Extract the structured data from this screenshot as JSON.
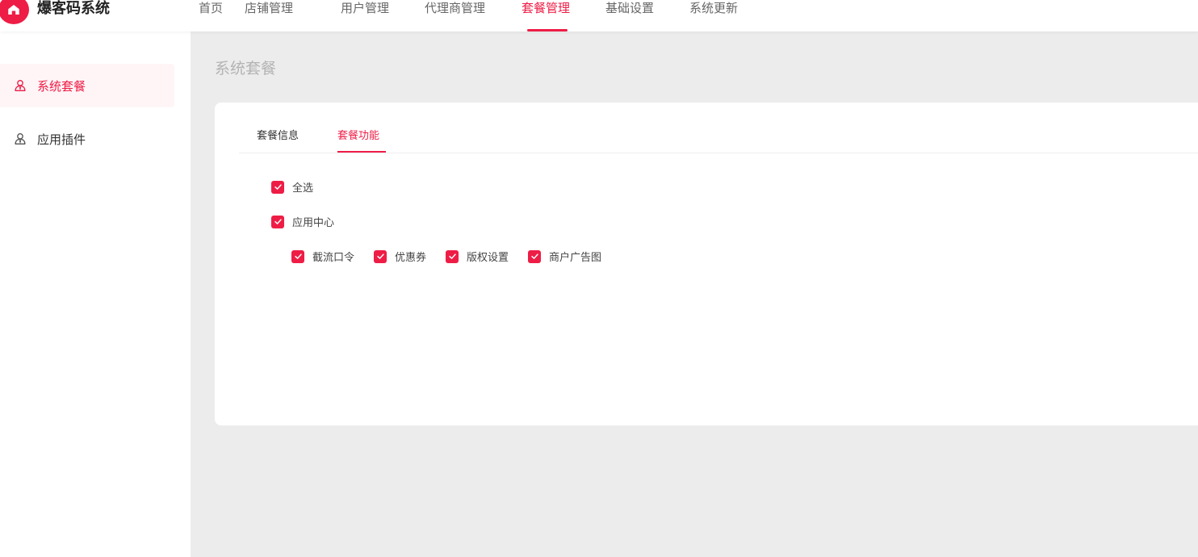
{
  "header": {
    "app_title": "爆客码系统",
    "nav": [
      {
        "label": "首页",
        "active": false
      },
      {
        "label": "店铺管理",
        "active": false
      },
      {
        "label": "用户管理",
        "active": false
      },
      {
        "label": "代理商管理",
        "active": false
      },
      {
        "label": "套餐管理",
        "active": true
      },
      {
        "label": "基础设置",
        "active": false
      },
      {
        "label": "系统更新",
        "active": false
      }
    ]
  },
  "sidebar": {
    "items": [
      {
        "label": "系统套餐",
        "icon": "user-icon",
        "active": true
      },
      {
        "label": "应用插件",
        "icon": "user-icon",
        "active": false
      }
    ]
  },
  "main": {
    "page_title": "系统套餐",
    "tabs": [
      {
        "label": "套餐信息",
        "active": false
      },
      {
        "label": "套餐功能",
        "active": true
      }
    ],
    "select_all": {
      "label": "全选",
      "checked": true
    },
    "group": {
      "label": "应用中心",
      "checked": true
    },
    "features": [
      {
        "label": "截流口令",
        "checked": true
      },
      {
        "label": "优惠券",
        "checked": true
      },
      {
        "label": "版权设置",
        "checked": true
      },
      {
        "label": "商户广告图",
        "checked": true
      }
    ]
  },
  "colors": {
    "accent": "#ee1d46",
    "page_bg": "#ececec"
  }
}
